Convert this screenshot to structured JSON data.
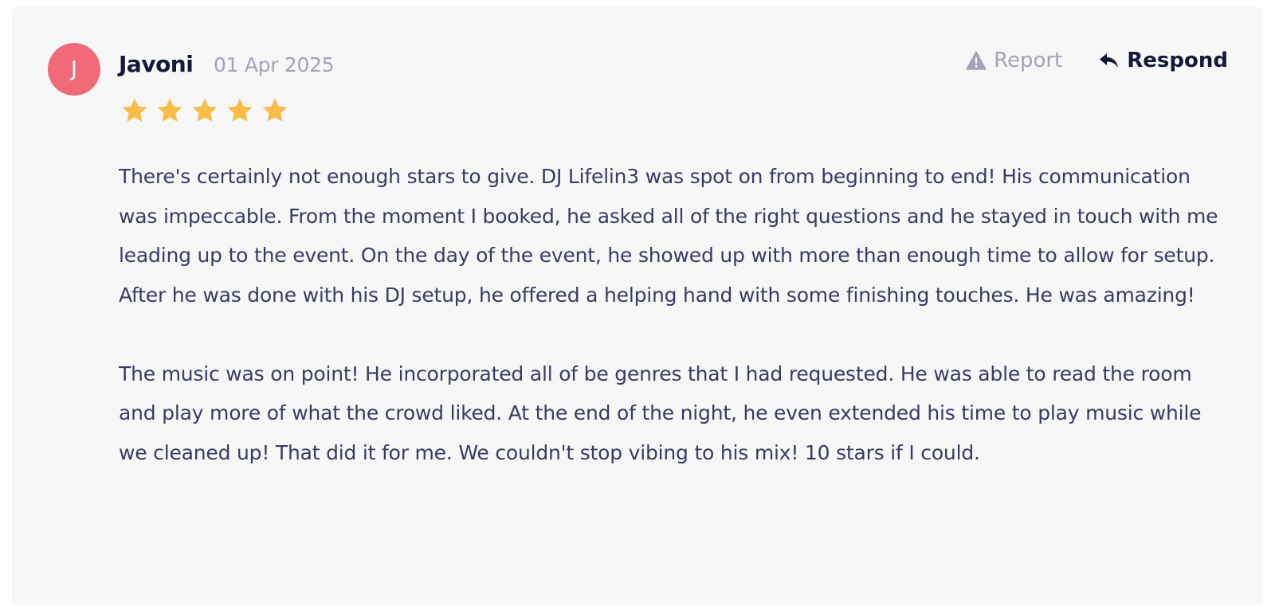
{
  "review": {
    "avatar_initial": "J",
    "author": "Javoni",
    "date": "01 Apr 2025",
    "rating": 5,
    "rating_max": 5,
    "report_label": "Report",
    "respond_label": "Respond",
    "paragraphs": [
      "There's certainly not enough stars to give. DJ Lifelin3 was spot on from beginning to end! His communication was impeccable. From the moment I booked, he asked all of the right questions and he stayed in touch with me leading up to the event. On the day of the event, he showed up with more than enough time to allow for setup. After he was done with his DJ setup, he offered a helping hand with some finishing touches. He was amazing!",
      "The music was on point! He incorporated all of be genres that I had requested. He was able to read the room and play more of what the crowd liked. At the end of the night, he even extended his time to play music while we cleaned up! That did it for me. We couldn't stop vibing to his mix! 10 stars if I could."
    ]
  },
  "icons": {
    "report": "warning-triangle-icon",
    "respond": "reply-arrow-icon",
    "rating": "star-icon"
  },
  "colors": {
    "avatar_bg": "#f06a7a",
    "star": "#f8bc48",
    "card_bg": "#f7f7f7",
    "text_dark": "#14193a",
    "text_body": "#383c63",
    "text_muted": "#a2a5b7"
  }
}
